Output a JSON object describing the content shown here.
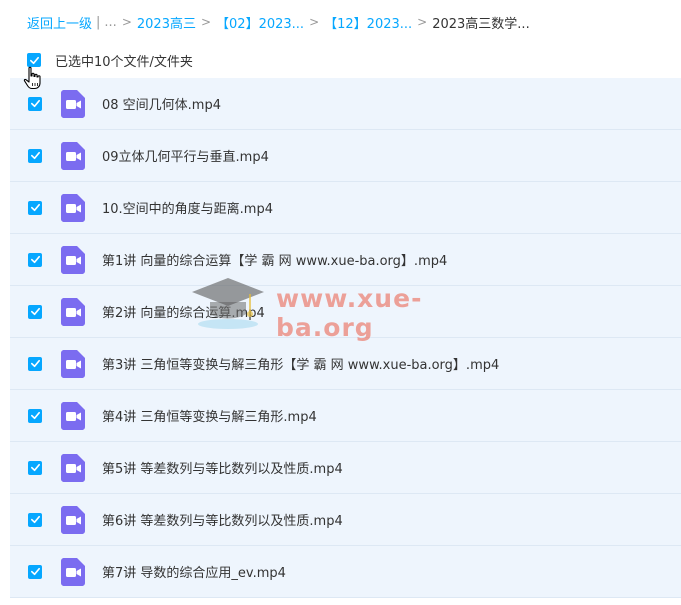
{
  "breadcrumb": {
    "back": "返回上一级",
    "pipe": "|",
    "ellipsis": "...",
    "sep": ">",
    "items": [
      "2023高三",
      "【02】2023...",
      "【12】2023..."
    ],
    "current": "2023高三数学..."
  },
  "selection": {
    "text": "已选中10个文件/文件夹",
    "checked": true
  },
  "files": [
    {
      "name": "08 空间几何体.mp4",
      "checked": true
    },
    {
      "name": "09立体几何平行与垂直.mp4",
      "checked": true
    },
    {
      "name": "10.空间中的角度与距离.mp4",
      "checked": true
    },
    {
      "name": "第1讲 向量的综合运算【学 霸 网 www.xue-ba.org】.mp4",
      "checked": true
    },
    {
      "name": "第2讲 向量的综合运算.mp4",
      "checked": true
    },
    {
      "name": "第3讲 三角恒等变换与解三角形【学 霸 网 www.xue-ba.org】.mp4",
      "checked": true
    },
    {
      "name": "第4讲 三角恒等变换与解三角形.mp4",
      "checked": true
    },
    {
      "name": "第5讲 等差数列与等比数列以及性质.mp4",
      "checked": true
    },
    {
      "name": "第6讲 等差数列与等比数列以及性质.mp4",
      "checked": true
    },
    {
      "name": "第7讲 导数的综合应用_ev.mp4",
      "checked": true
    }
  ],
  "watermark": {
    "text": "www.xue-ba.org"
  },
  "colors": {
    "accent": "#06a7ff",
    "row_bg": "#eef5fd",
    "video_icon": "#7b6cf0"
  }
}
